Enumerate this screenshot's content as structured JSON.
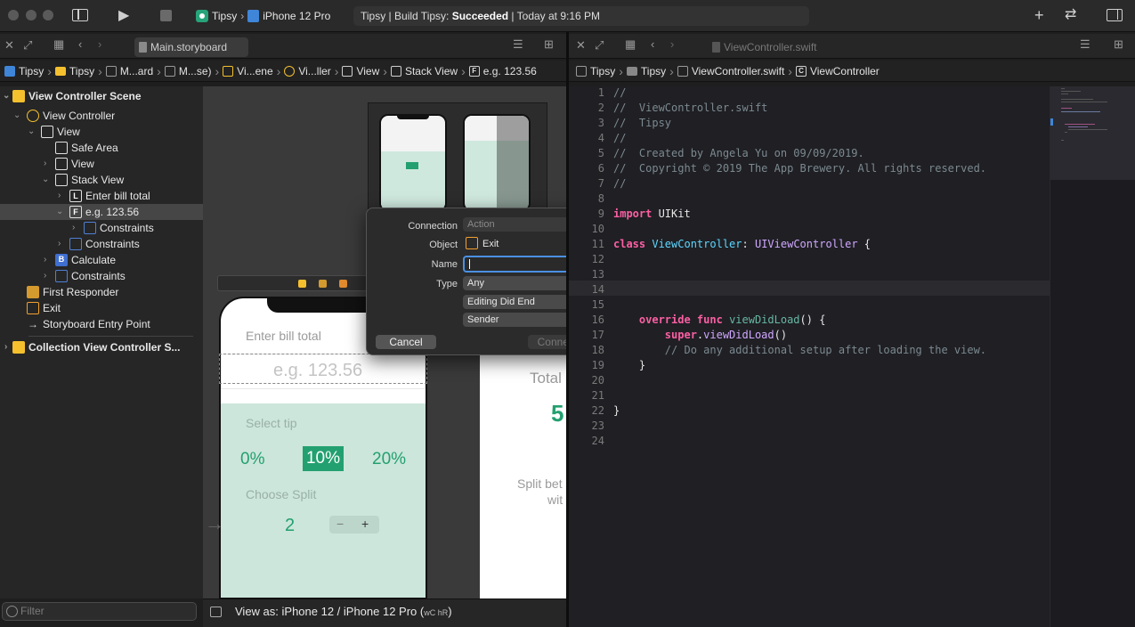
{
  "toolbar": {
    "scheme_app": "Tipsy",
    "scheme_device": "iPhone 12 Pro",
    "status_prefix": "Tipsy | Build Tipsy: ",
    "status_result": "Succeeded",
    "status_suffix": " | Today at 9:16 PM"
  },
  "left_editor": {
    "tab_label": "Main.storyboard",
    "breadcrumbs": [
      "Tipsy",
      "Tipsy",
      "M...ard",
      "M...se)",
      "Vi...ene",
      "Vi...ller",
      "View",
      "Stack View",
      "e.g. 123.56"
    ]
  },
  "navigator": {
    "items": [
      {
        "label": "View Controller Scene"
      },
      {
        "label": "View Controller"
      },
      {
        "label": "View"
      },
      {
        "label": "Safe Area"
      },
      {
        "label": "View"
      },
      {
        "label": "Stack View"
      },
      {
        "label": "Enter bill total"
      },
      {
        "label": "e.g. 123.56"
      },
      {
        "label": "Constraints"
      },
      {
        "label": "Constraints"
      },
      {
        "label": "Calculate"
      },
      {
        "label": "Constraints"
      },
      {
        "label": "First Responder"
      },
      {
        "label": "Exit"
      },
      {
        "label": "Storyboard Entry Point"
      },
      {
        "label": "Collection View Controller S..."
      }
    ],
    "filter_placeholder": "Filter"
  },
  "canvas": {
    "bill_label": "Enter bill total",
    "bill_placeholder": "e.g. 123.56",
    "select_tip": "Select tip",
    "tip_options": [
      "0%",
      "10%",
      "20%"
    ],
    "choose_split": "Choose Split",
    "split_value": "2",
    "stepper_minus": "−",
    "stepper_plus": "+",
    "result_total": "Total",
    "result_value": "5",
    "result_split_line1": "Split bet",
    "result_split_line2": "wit",
    "view_as": "View as: iPhone 12 / iPhone 12 Pro (",
    "view_as_size": "wC hR",
    "view_as_end": ")"
  },
  "popover": {
    "connection_label": "Connection",
    "connection_value": "Action",
    "object_label": "Object",
    "object_value": "Exit",
    "name_label": "Name",
    "name_value": "",
    "type_label": "Type",
    "type_value": "Any",
    "event_value": "Editing Did End",
    "arguments_value": "Sender",
    "cancel_label": "Cancel",
    "connect_label": "Connect"
  },
  "right_editor": {
    "tab_label": "ViewController.swift",
    "breadcrumbs": [
      "Tipsy",
      "Tipsy",
      "ViewController.swift",
      "ViewController"
    ],
    "line_numbers": [
      "1",
      "2",
      "3",
      "4",
      "5",
      "6",
      "7",
      "8",
      "9",
      "10",
      "11",
      "12",
      "13",
      "14",
      "15",
      "16",
      "17",
      "18",
      "19",
      "20",
      "21",
      "22",
      "23",
      "24"
    ],
    "code": {
      "l1": "//",
      "l2": "//  ViewController.swift",
      "l3": "//  Tipsy",
      "l4": "//",
      "l5": "//  Created by Angela Yu on 09/09/2019.",
      "l6": "//  Copyright © 2019 The App Brewery. All rights reserved.",
      "l7": "//",
      "l9_kw": "import",
      "l9_rest": " UIKit",
      "l11_kw": "class",
      "l11_name": "ViewController",
      "l11_colon": ": ",
      "l11_super": "UIViewController",
      "l11_end": " {",
      "l16_kw": "override func",
      "l16_fn": "viewDidLoad",
      "l16_end": "() {",
      "l17_kw": "super",
      "l17_dot": ".",
      "l17_fn": "viewDidLoad",
      "l17_end": "()",
      "l18": "// Do any additional setup after loading the view.",
      "l19": "}",
      "l22": "}"
    }
  }
}
